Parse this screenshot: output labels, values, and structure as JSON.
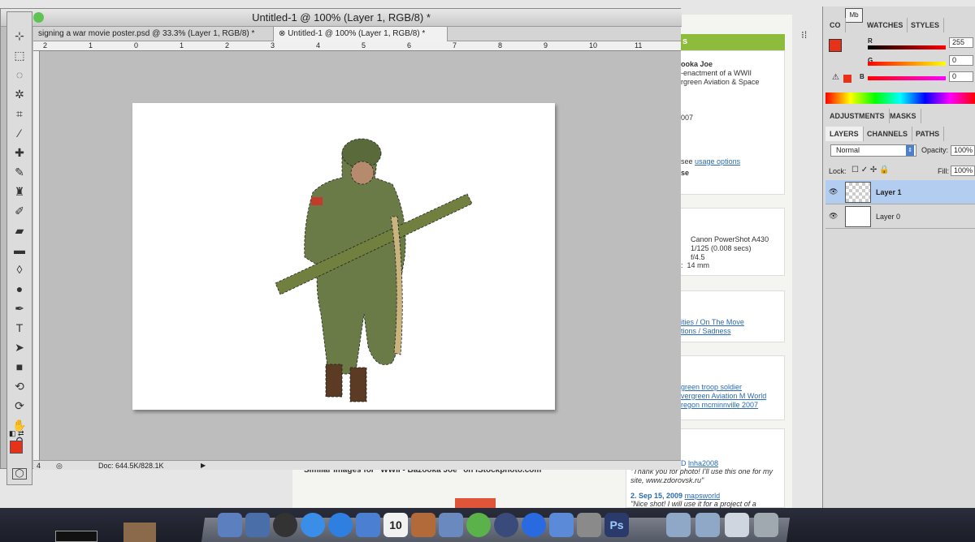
{
  "window": {
    "title": "Untitled-1 @ 100% (Layer 1, RGB/8) *",
    "tabs": [
      {
        "label": "signing a war movie poster.psd @ 33.3% (Layer 1, RGB/8) *"
      },
      {
        "label": "Untitled-1 @ 100% (Layer 1, RGB/8) *"
      }
    ],
    "ruler_marks": [
      "2",
      "1",
      "0",
      "1",
      "2",
      "3",
      "4",
      "5",
      "6",
      "7",
      "8",
      "9",
      "10",
      "11"
    ],
    "status": {
      "zoom": "4",
      "doc": "Doc: 644.5K/828.1K"
    }
  },
  "webpage": {
    "header": "s",
    "title_frag": "ooka Joe",
    "desc1": "-enactment of a WWII",
    "desc2": "rgreen Aviation & Space",
    "year": "007",
    "see": "see",
    "usage_link": "usage options",
    "license": "se",
    "exif": [
      "Canon PowerShot A430",
      "1/125 (0.008 secs)",
      "f/4.5",
      "14 mm"
    ],
    "exif_prefix": ":",
    "sets1": "ities / On The Move",
    "sets2": "tions / Sadness",
    "tags1": "green troop soldier",
    "tags2": "vergreen Aviation M World",
    "tags3": "regon mcminnville 2007",
    "similar": "Similar images for \"WWII - Bazooka Joe\" on iStockphoto.com",
    "c1_user": "lnha2008",
    "c1_text": "\"Thank you for photo! I'll use this one for my site, www.zdorovsk.ru\"",
    "c2_num": "2. Sep 15, 2009",
    "c2_user": "mapsworld",
    "c2_text": "\"Nice shot! I will use it for a project of a"
  },
  "color_panel": {
    "tabs": [
      "CO",
      "WATCHES",
      "STYLES"
    ],
    "r_label": "R",
    "r_value": "255",
    "g_label": "G",
    "g_value": "0",
    "b_label": "B",
    "b_value": "0",
    "fg_color": "#e63219"
  },
  "adjust_tabs": [
    "ADJUSTMENTS",
    "MASKS"
  ],
  "layers_panel": {
    "tabs": [
      "LAYERS",
      "CHANNELS",
      "PATHS"
    ],
    "blend_mode": "Normal",
    "opacity_label": "Opacity:",
    "opacity": "100%",
    "lock_label": "Lock:",
    "fill_label": "Fill:",
    "fill": "100%",
    "layers": [
      {
        "name": "Layer 1",
        "selected": true
      },
      {
        "name": "Layer 0",
        "selected": false
      }
    ],
    "badge": "Mb"
  },
  "dock": {
    "calendar_day": "10",
    "ps_label": "Ps"
  }
}
